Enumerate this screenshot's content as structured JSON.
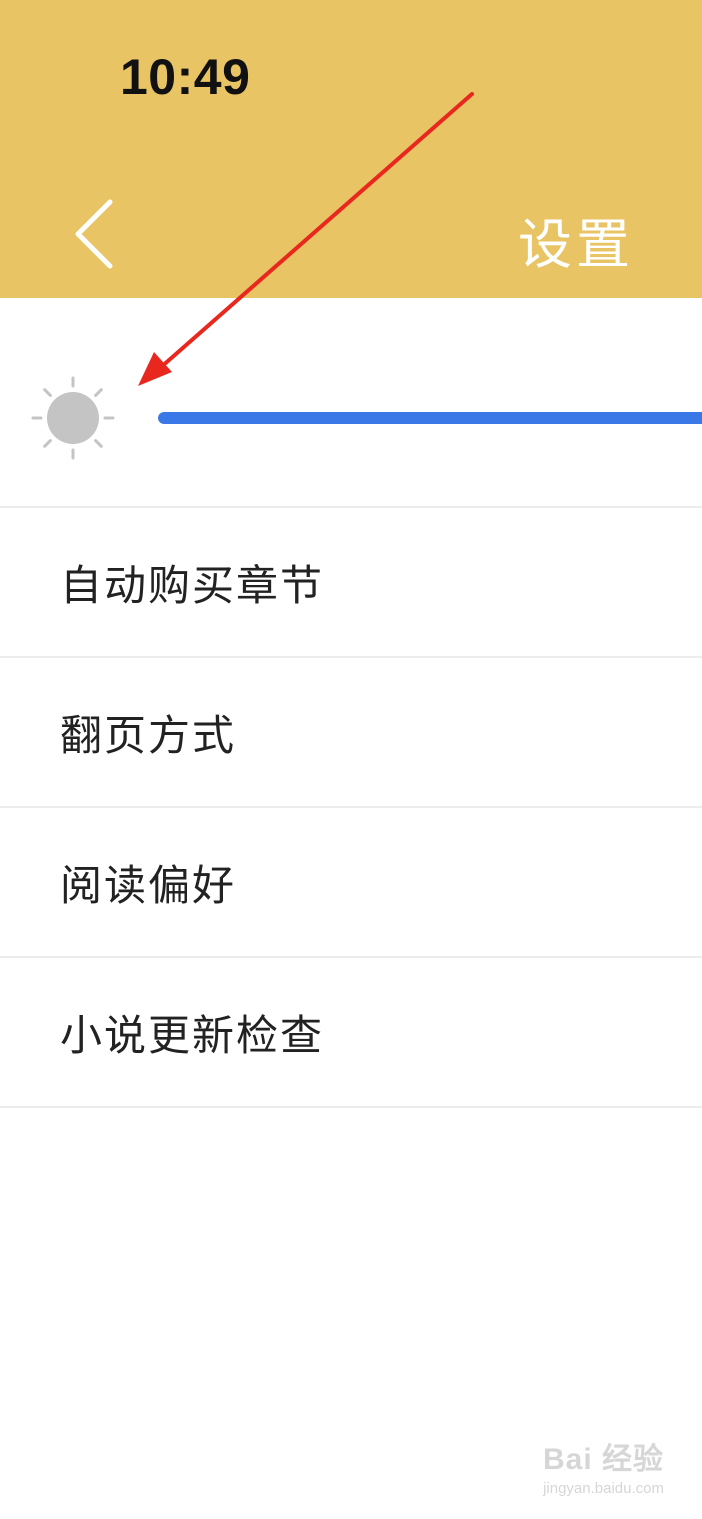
{
  "status_bar": {
    "time": "10:49"
  },
  "header": {
    "title": "设置",
    "back_icon": "chevron-left-icon",
    "background_color": "#e8c464"
  },
  "brightness": {
    "icon": "sun-icon",
    "level_fraction": 1.0,
    "accent_color": "#3b78e7"
  },
  "menu": {
    "items": [
      {
        "label": "自动购买章节"
      },
      {
        "label": "翻页方式"
      },
      {
        "label": "阅读偏好"
      },
      {
        "label": "小说更新检查"
      }
    ]
  },
  "annotation": {
    "type": "red-arrow",
    "points_to": "sun-icon",
    "color": "#e8281e"
  },
  "watermark": {
    "text": "Bai 经验",
    "url_text": "jingyan.baidu.com"
  }
}
